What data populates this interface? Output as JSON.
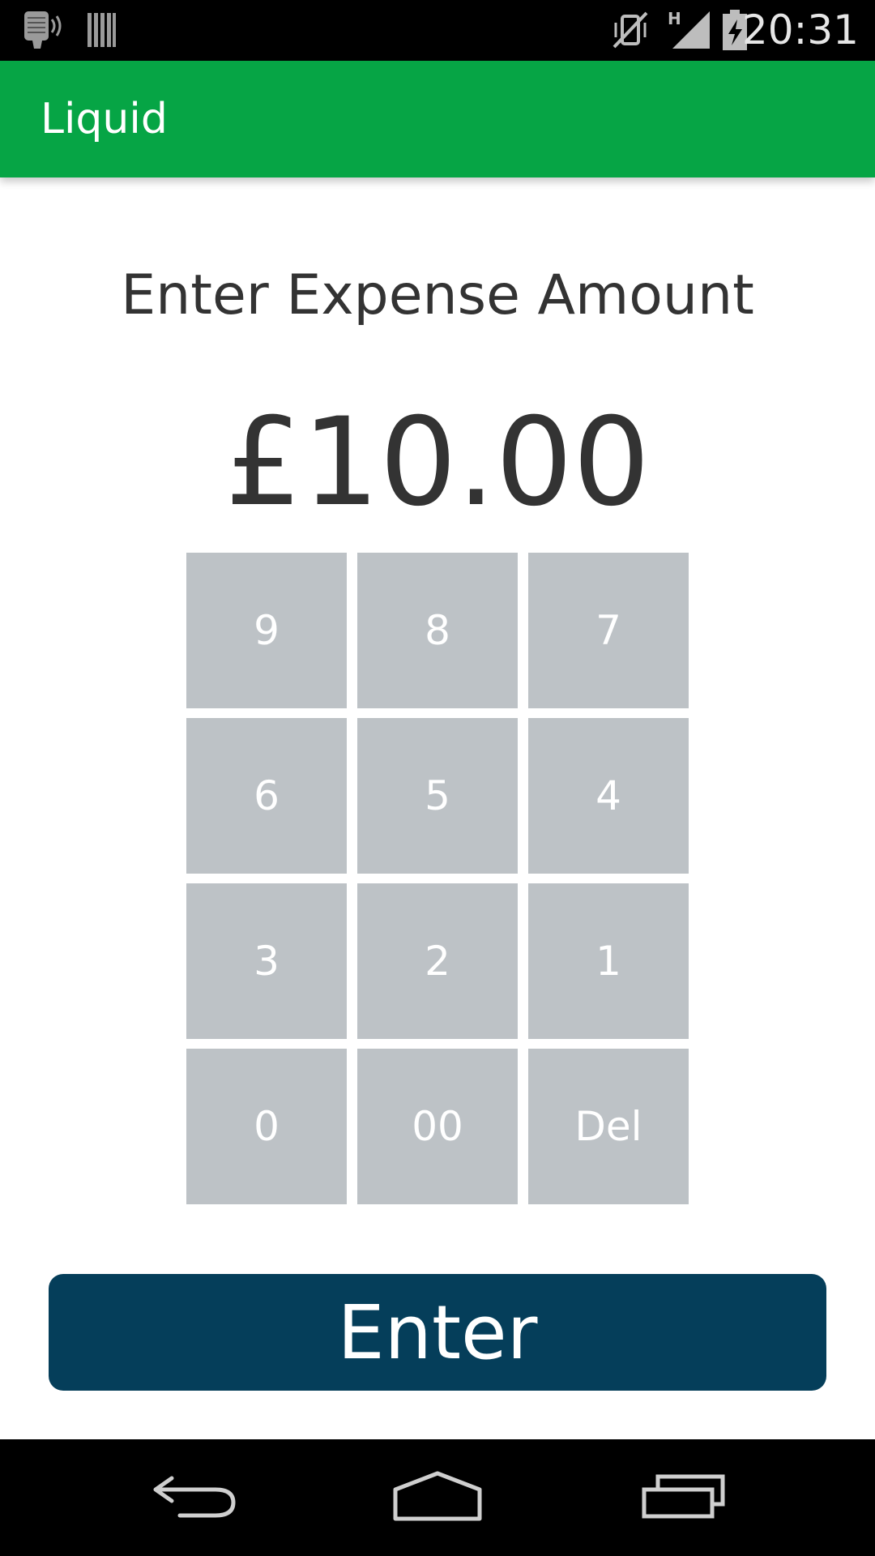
{
  "status_bar": {
    "time": "20:31",
    "network_type": "H",
    "icons": [
      "voice-recorder-icon",
      "barcode-icon",
      "vibrate-mute-icon",
      "signal-icon",
      "battery-charging-icon"
    ]
  },
  "app_bar": {
    "title": "Liquid",
    "background_color": "#06a545"
  },
  "main": {
    "prompt": "Enter Expense Amount",
    "amount": "£10.00"
  },
  "keypad": {
    "keys": [
      "9",
      "8",
      "7",
      "6",
      "5",
      "4",
      "3",
      "2",
      "1",
      "0",
      "00",
      "Del"
    ],
    "key_color": "#bdc2c6"
  },
  "enter_button": {
    "label": "Enter",
    "color": "#053e5a"
  },
  "nav_bar": {
    "icons": [
      "back-icon",
      "home-icon",
      "recent-apps-icon"
    ]
  }
}
